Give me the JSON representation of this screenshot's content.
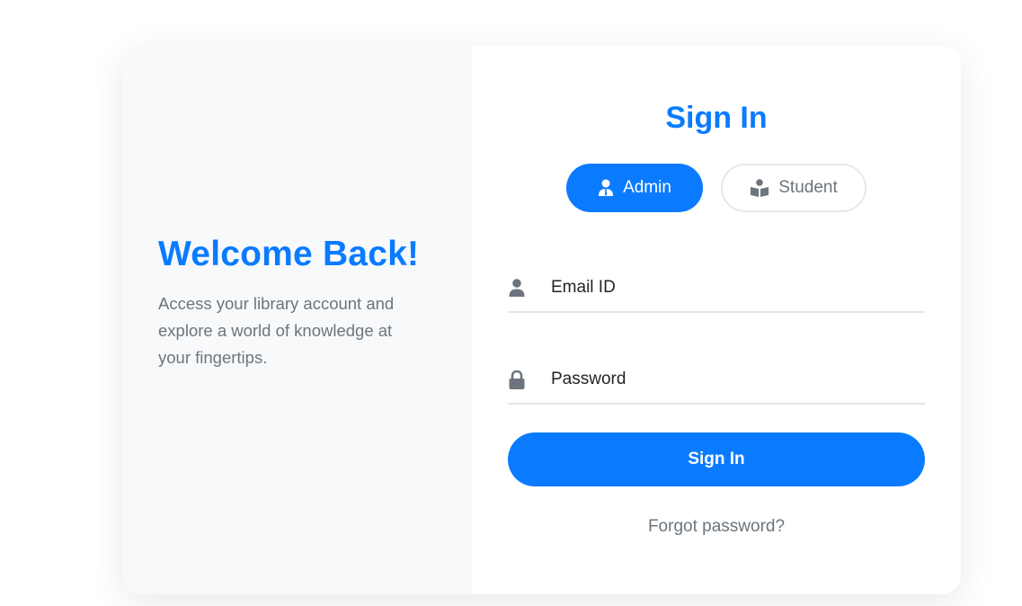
{
  "left": {
    "title": "Welcome Back!",
    "description": "Access your library account and explore a world of knowledge at your fingertips."
  },
  "signin": {
    "title": "Sign In",
    "roles": [
      {
        "label": "Admin",
        "icon": "user-tie-icon",
        "selected": true
      },
      {
        "label": "Student",
        "icon": "book-reader-icon",
        "selected": false
      }
    ],
    "email": {
      "placeholder": "Email ID",
      "value": "",
      "icon": "user-icon"
    },
    "password": {
      "placeholder": "Password",
      "value": "",
      "icon": "lock-icon"
    },
    "submit_label": "Sign In",
    "forgot_label": "Forgot password?"
  },
  "colors": {
    "accent": "#0a7bff",
    "muted_text": "#6c757d",
    "left_panel_bg": "#f7f9fb"
  }
}
